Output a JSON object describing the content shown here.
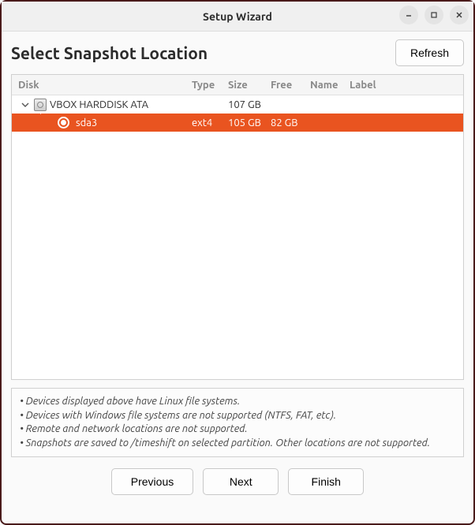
{
  "window": {
    "title": "Setup Wizard"
  },
  "header": {
    "title": "Select Snapshot Location",
    "refresh_label": "Refresh"
  },
  "table": {
    "columns": {
      "disk": "Disk",
      "type": "Type",
      "size": "Size",
      "free": "Free",
      "name": "Name",
      "label": "Label"
    },
    "rows": [
      {
        "kind": "parent",
        "disk": "VBOX HARDDISK ATA",
        "type": "",
        "size": "107 GB",
        "free": "",
        "name": "",
        "label": ""
      },
      {
        "kind": "child",
        "selected": true,
        "disk": "sda3",
        "type": "ext4",
        "size": "105 GB",
        "free": "82 GB",
        "name": "",
        "label": ""
      }
    ]
  },
  "notes": {
    "n1": "• Devices displayed above have Linux file systems.",
    "n2": "• Devices with Windows file systems are not supported (NTFS, FAT, etc).",
    "n3": "• Remote and network locations are not supported.",
    "n4": "• Snapshots are saved to /timeshift on selected partition. Other locations are not supported."
  },
  "footer": {
    "previous": "Previous",
    "next": "Next",
    "finish": "Finish"
  }
}
